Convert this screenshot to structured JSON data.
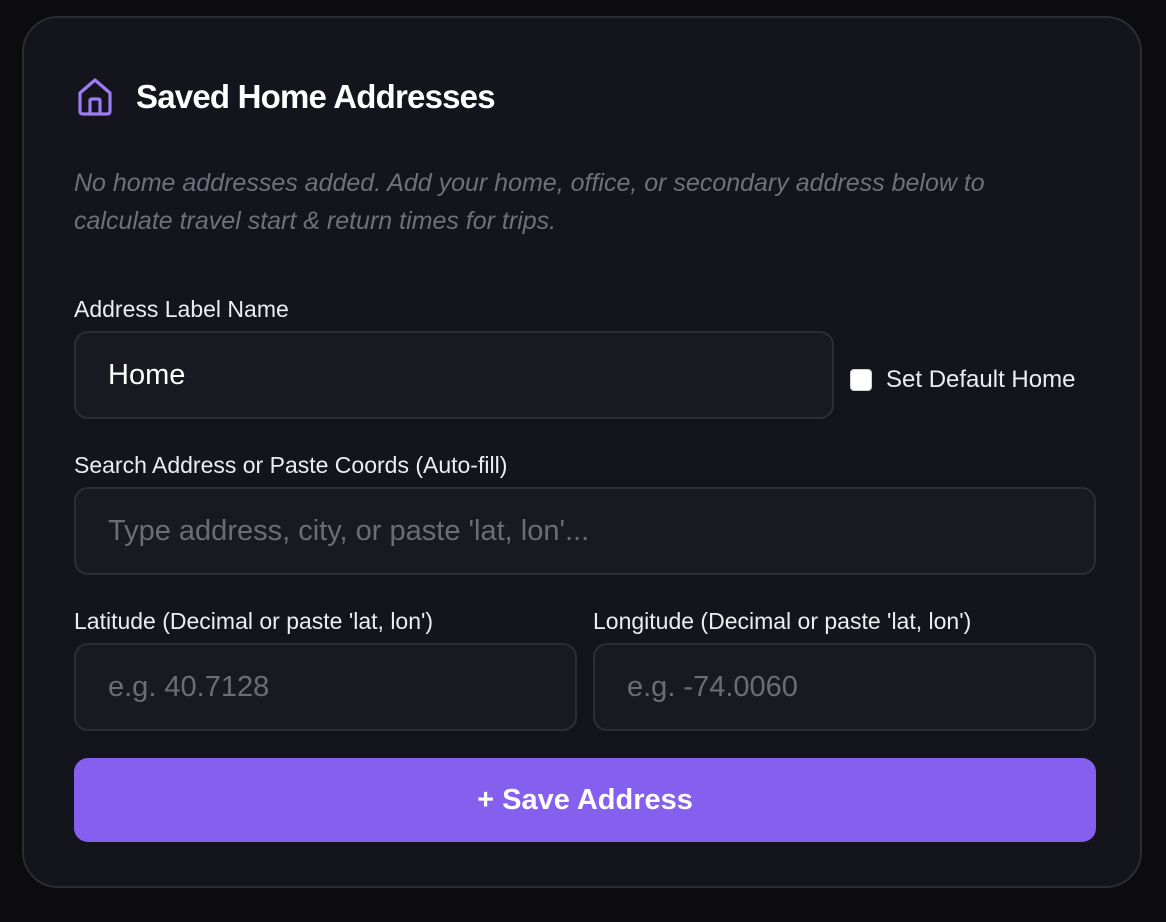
{
  "card": {
    "title": "Saved Home Addresses",
    "icon": "home-icon",
    "description": "No home addresses added. Add your home, office, or secondary address below to calculate travel start & return times for trips."
  },
  "form": {
    "label_name": {
      "label": "Address Label Name",
      "value": "Home"
    },
    "default_home": {
      "label": "Set Default Home",
      "checked": false
    },
    "search": {
      "label": "Search Address or Paste Coords (Auto-fill)",
      "placeholder": "Type address, city, or paste 'lat, lon'..."
    },
    "latitude": {
      "label": "Latitude (Decimal or paste 'lat, lon')",
      "placeholder": "e.g. 40.7128"
    },
    "longitude": {
      "label": "Longitude (Decimal or paste 'lat, lon')",
      "placeholder": "e.g. -74.0060"
    },
    "save_label": "+ Save Address"
  },
  "colors": {
    "accent": "#8560ee",
    "icon": "#9b7cf2",
    "card_bg": "#14151c",
    "page_bg": "#0c0c0e"
  }
}
